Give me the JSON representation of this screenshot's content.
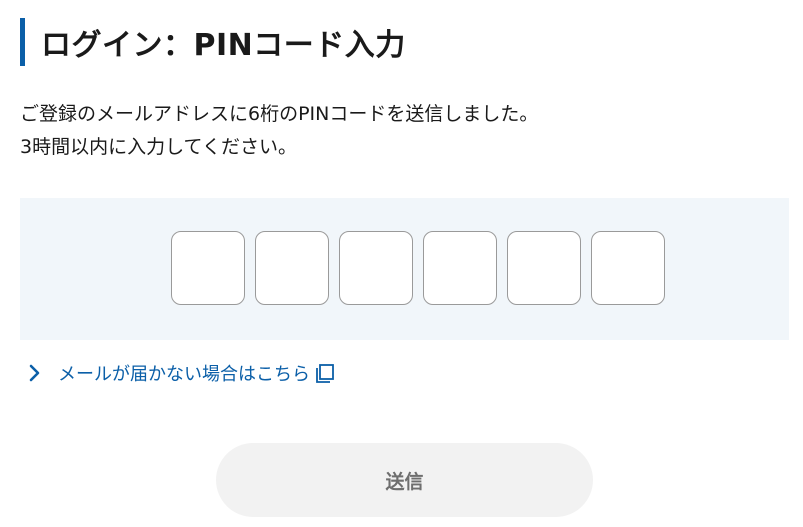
{
  "header": {
    "title": "ログイン：PINコード入力"
  },
  "description": {
    "line1": "ご登録のメールアドレスに6桁のPINコードを送信しました。",
    "line2": "3時間以内に入力してください。"
  },
  "pin": {
    "digits": [
      "",
      "",
      "",
      "",
      "",
      ""
    ]
  },
  "help_link": {
    "label": "メールが届かない場合はこちら",
    "icon": "external-link-icon"
  },
  "submit": {
    "label": "送信",
    "enabled": false
  },
  "colors": {
    "accent": "#0b5fa8",
    "panel_bg": "#f1f6fa",
    "button_bg": "#f2f2f2",
    "button_text": "#6e6e6e"
  }
}
